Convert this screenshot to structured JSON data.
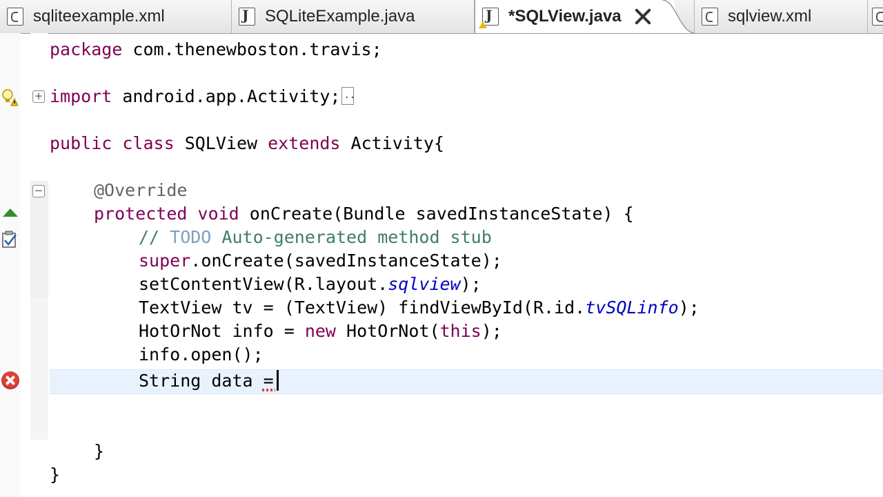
{
  "tabs": [
    {
      "label": "sqliteexample.xml",
      "icon": "xml-file-icon",
      "active": false
    },
    {
      "label": "SQLiteExample.java",
      "icon": "java-file-icon",
      "active": false
    },
    {
      "label": "*SQLView.java",
      "icon": "java-file-icon",
      "active": true
    },
    {
      "label": "sqlview.xml",
      "icon": "xml-file-icon",
      "active": false
    }
  ],
  "code": {
    "l1_kw": "package",
    "l1_rest": " com.thenewboston.travis;",
    "l2_kw": "import",
    "l2_rest": " android.app.Activity;",
    "l3_kw1": "public",
    "l3_kw2": "class",
    "l3_name": " SQLView ",
    "l3_kw3": "extends",
    "l3_rest": " Activity{",
    "l4_ann": "@Override",
    "l5_kw1": "protected",
    "l5_kw2": "void",
    "l5_rest": " onCreate(Bundle savedInstanceState) {",
    "l6_cm1": "// ",
    "l6_todo": "TODO",
    "l6_cm2": " Auto-generated method stub",
    "l7_kw": "super",
    "l7_rest": ".onCreate(savedInstanceState);",
    "l8_a": "setContentView(R.layout.",
    "l8_fld": "sqlview",
    "l8_b": ");",
    "l9_a": "TextView tv = (TextView) findViewById(R.id.",
    "l9_fld": "tvSQLinfo",
    "l9_b": ");",
    "l10_a": "HotOrNot info = ",
    "l10_kw": "new",
    "l10_b": " HotOrNot(",
    "l10_kw2": "this",
    "l10_c": ");",
    "l11": "info.open();",
    "l12_a": "String data ",
    "l12_eq": "=",
    "l13": "}",
    "l14": "}"
  },
  "colors": {
    "keyword": "#7f0055",
    "comment": "#3f7f5f",
    "field": "#0000c0",
    "current_line": "#e8f2fe"
  }
}
